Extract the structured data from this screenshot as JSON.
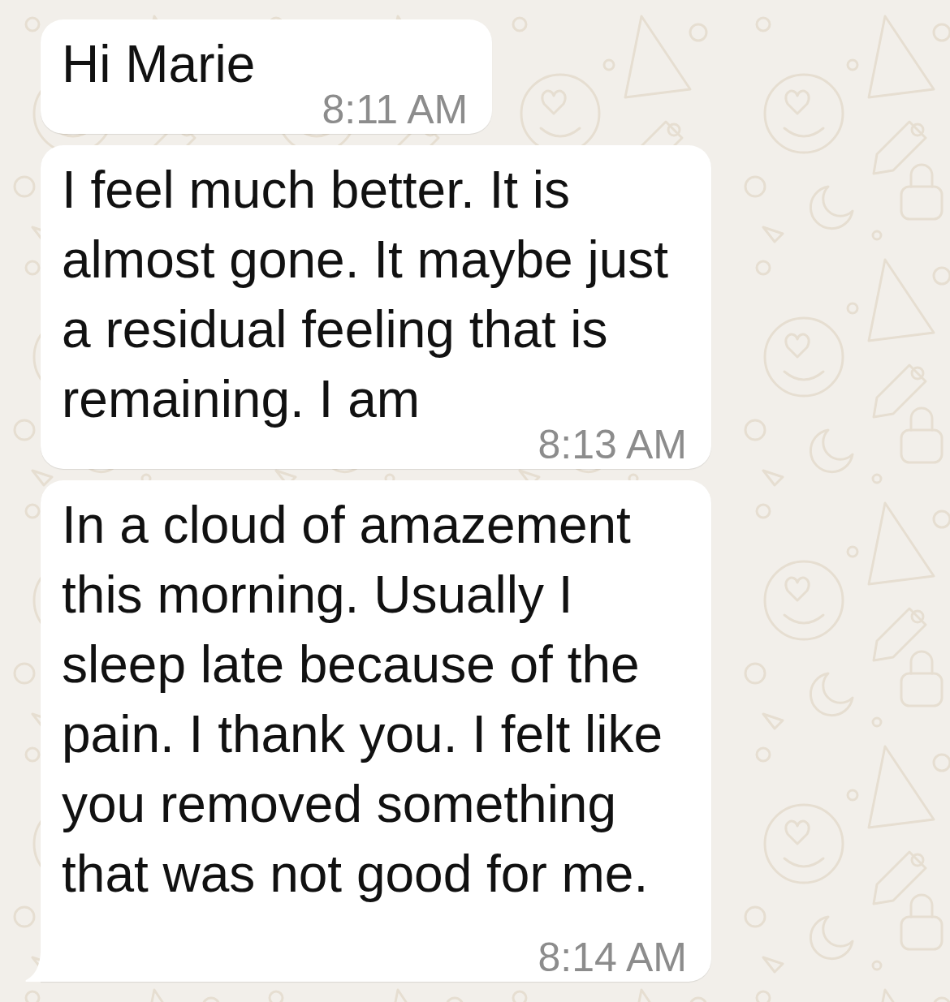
{
  "messages": [
    {
      "text": "Hi Marie",
      "time": "8:11 AM",
      "tail": false
    },
    {
      "text": "I feel much better. It is almost gone. It maybe just a residual feeling that is remaining. I am",
      "time": "8:13 AM",
      "tail": false
    },
    {
      "text": "In a cloud of amazement this morning. Usually I sleep late because of the pain. I thank you. I felt like you removed something that was not good for me.",
      "time": "8:14 AM",
      "tail": true
    }
  ]
}
